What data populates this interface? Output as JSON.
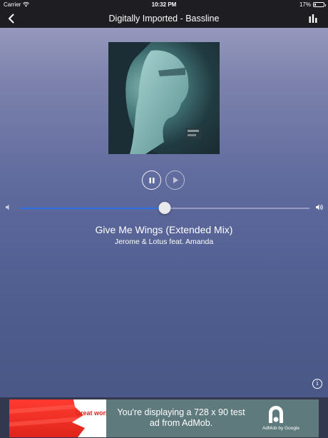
{
  "status_bar": {
    "carrier": "Carrier",
    "time": "10:32 PM",
    "battery_percent": "17%",
    "battery_level": 0.17
  },
  "nav": {
    "title": "Digitally Imported - Bassline",
    "back_icon": "chevron-left-icon",
    "equalizer_icon": "equalizer-icon"
  },
  "player": {
    "state": "playing",
    "volume_level": 0.5,
    "track_title": "Give Me Wings (Extended Mix)",
    "artist": "Jerome & Lotus feat. Amanda",
    "accent_color": "#2f6fe8"
  },
  "ad": {
    "badge_text": "Great work!",
    "message": "You're displaying a 728 x 90 test ad from AdMob.",
    "brand": "AdMob by Google",
    "red_color": "#e0241b",
    "panel_color": "#5f7a7d"
  }
}
